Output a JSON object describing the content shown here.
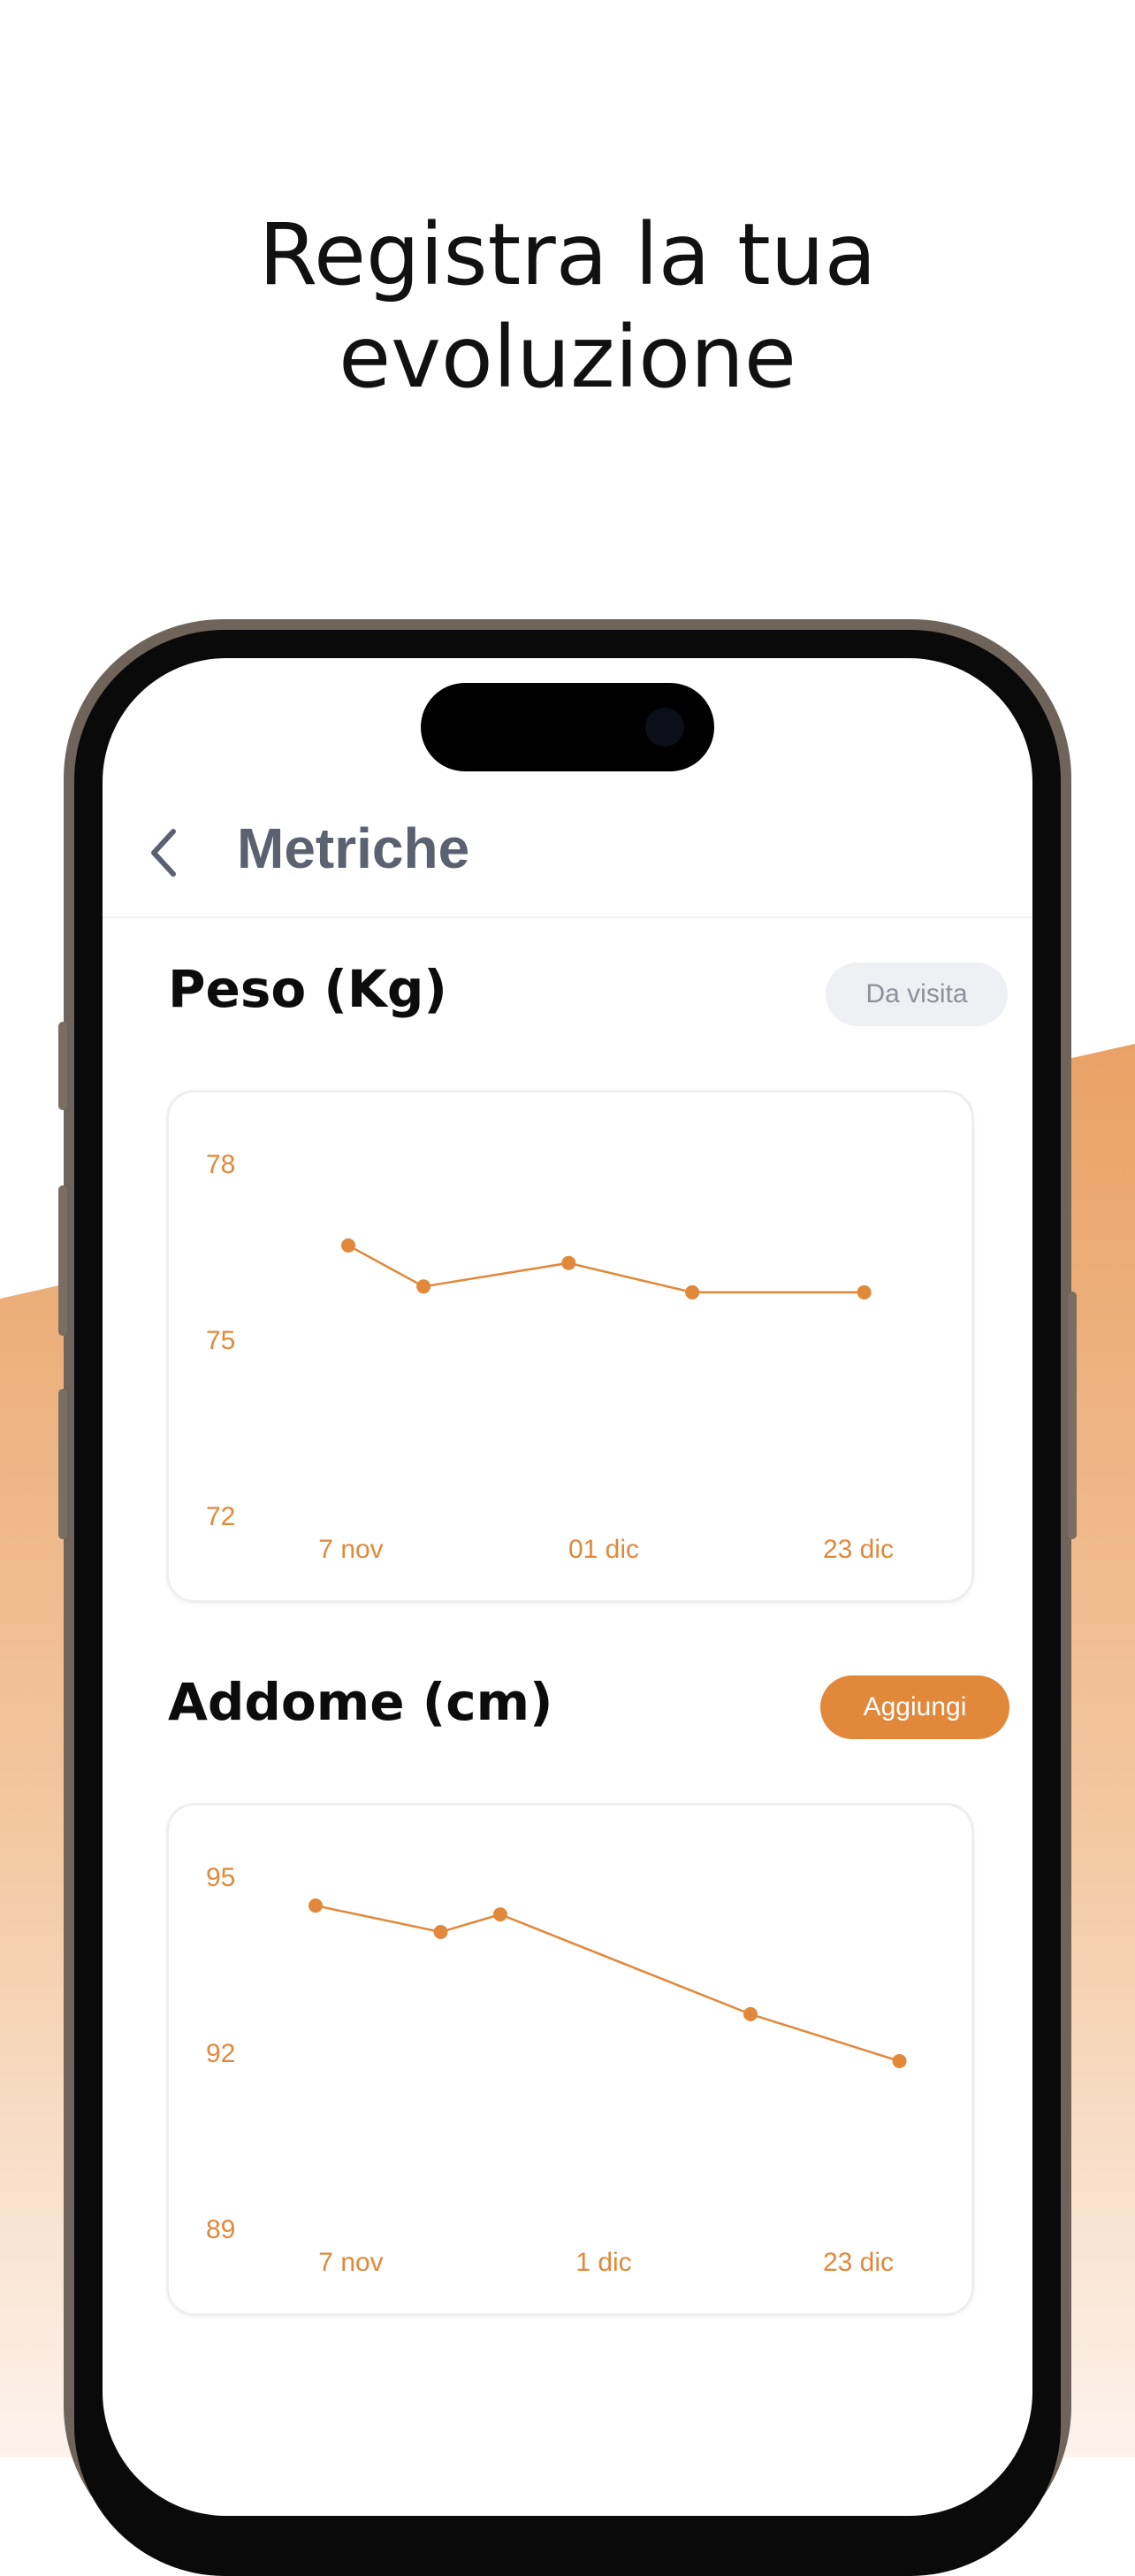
{
  "headline": {
    "line1": "Registra la tua",
    "line2": "evoluzione"
  },
  "colors": {
    "accent": "#e2883a",
    "title": "#5b6170",
    "pill_grey": "#eef0f3"
  },
  "nav": {
    "back_icon": "chevron-left-icon",
    "title": "Metriche"
  },
  "weight": {
    "title": "Peso (Kg)",
    "badge": "Da visita",
    "chart_data": {
      "type": "line",
      "y_ticks": [
        "78",
        "75",
        "72"
      ],
      "ylim": [
        72,
        78
      ],
      "x_tick_labels": [
        "7 nov",
        "01 dic",
        "23 dic"
      ],
      "points": [
        {
          "x": 0.0,
          "y": 76.6
        },
        {
          "x": 0.14,
          "y": 75.9
        },
        {
          "x": 0.41,
          "y": 76.3
        },
        {
          "x": 0.64,
          "y": 75.8
        },
        {
          "x": 0.96,
          "y": 75.8
        }
      ]
    }
  },
  "abdomen": {
    "title": "Addome (cm)",
    "button": "Aggiungi",
    "chart_data": {
      "type": "line",
      "y_ticks": [
        "95",
        "92",
        "89"
      ],
      "ylim": [
        89,
        95
      ],
      "x_tick_labels": [
        "7 nov",
        "1 dic",
        "23 dic"
      ],
      "points": [
        {
          "x": 0.0,
          "y": 94.5
        },
        {
          "x": 0.21,
          "y": 94.05
        },
        {
          "x": 0.31,
          "y": 94.35
        },
        {
          "x": 0.73,
          "y": 92.65
        },
        {
          "x": 0.98,
          "y": 91.85
        }
      ]
    }
  }
}
